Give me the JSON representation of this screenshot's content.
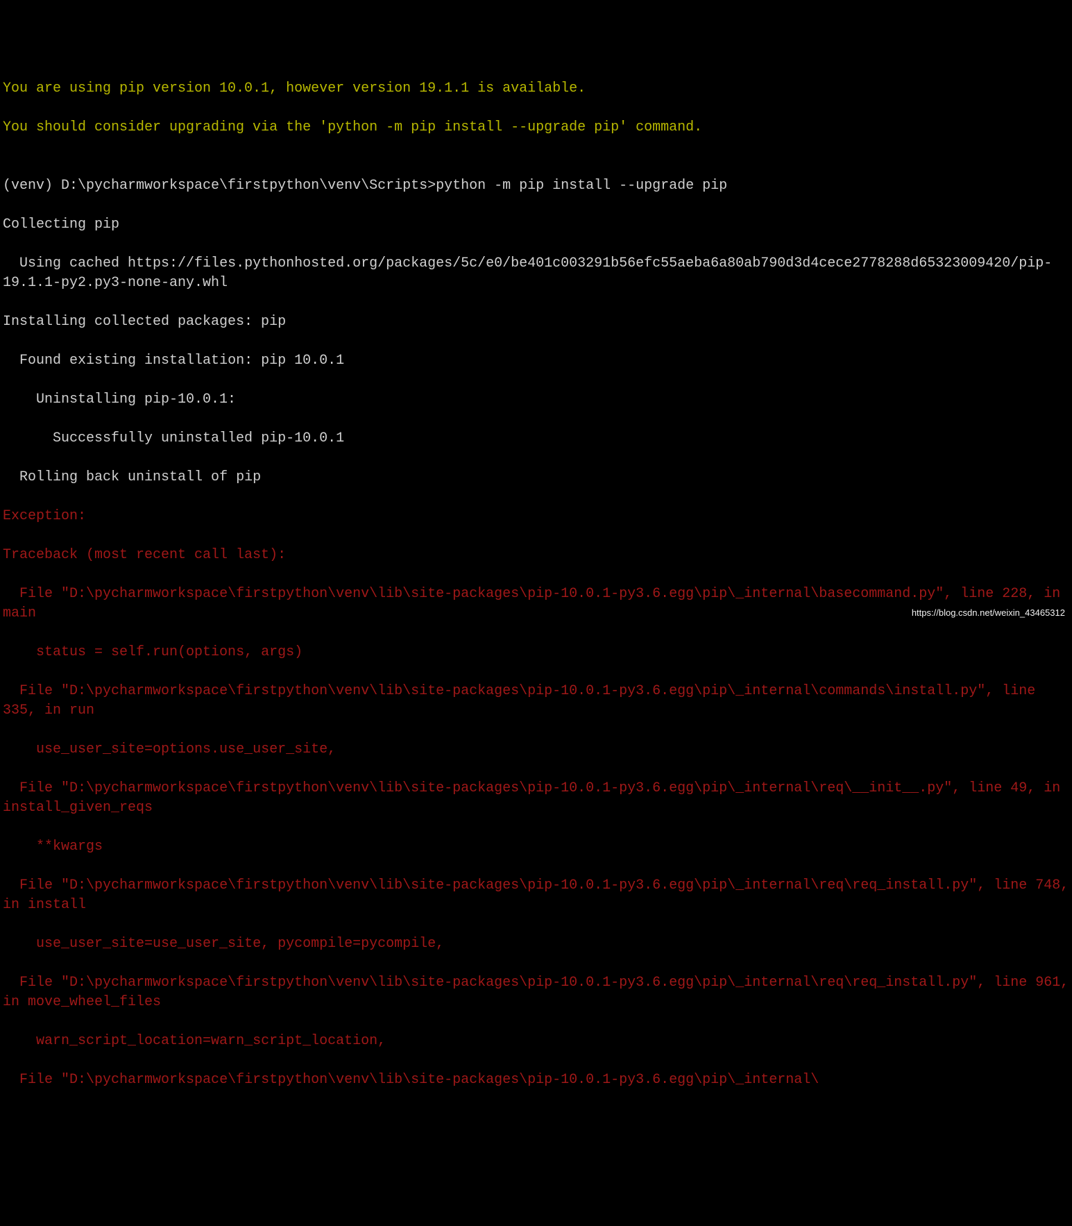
{
  "terminal": {
    "warning_line1": "You are using pip version 10.0.1, however version 19.1.1 is available.",
    "warning_line2": "You should consider upgrading via the 'python -m pip install --upgrade pip' command.",
    "blank": "",
    "prompt_line": "(venv) D:\\pycharmworkspace\\firstpython\\venv\\Scripts>python -m pip install --upgrade pip",
    "collecting": "Collecting pip",
    "cached": "  Using cached https://files.pythonhosted.org/packages/5c/e0/be401c003291b56efc55aeba6a80ab790d3d4cece2778288d65323009420/pip-19.1.1-py2.py3-none-any.whl",
    "installing": "Installing collected packages: pip",
    "found": "  Found existing installation: pip 10.0.1",
    "uninstalling": "    Uninstalling pip-10.0.1:",
    "success_uninstall": "      Successfully uninstalled pip-10.0.1",
    "rolling": "  Rolling back uninstall of pip",
    "exception": "Exception:",
    "traceback": "Traceback (most recent call last):",
    "file1": "  File \"D:\\pycharmworkspace\\firstpython\\venv\\lib\\site-packages\\pip-10.0.1-py3.6.egg\\pip\\_internal\\basecommand.py\", line 228, in main",
    "file1_code": "    status = self.run(options, args)",
    "file2": "  File \"D:\\pycharmworkspace\\firstpython\\venv\\lib\\site-packages\\pip-10.0.1-py3.6.egg\\pip\\_internal\\commands\\install.py\", line 335, in run",
    "file2_code": "    use_user_site=options.use_user_site,",
    "file3": "  File \"D:\\pycharmworkspace\\firstpython\\venv\\lib\\site-packages\\pip-10.0.1-py3.6.egg\\pip\\_internal\\req\\__init__.py\", line 49, in install_given_reqs",
    "file3_code": "    **kwargs",
    "file4": "  File \"D:\\pycharmworkspace\\firstpython\\venv\\lib\\site-packages\\pip-10.0.1-py3.6.egg\\pip\\_internal\\req\\req_install.py\", line 748, in install",
    "file4_code": "    use_user_site=use_user_site, pycompile=pycompile,",
    "file5": "  File \"D:\\pycharmworkspace\\firstpython\\venv\\lib\\site-packages\\pip-10.0.1-py3.6.egg\\pip\\_internal\\req\\req_install.py\", line 961, in move_wheel_files",
    "file5_code": "    warn_script_location=warn_script_location,",
    "file6": "  File \"D:\\pycharmworkspace\\firstpython\\venv\\lib\\site-packages\\pip-10.0.1-py3.6.egg\\pip\\_internal\\"
  },
  "watermark": "https://blog.csdn.net/weixin_43465312"
}
